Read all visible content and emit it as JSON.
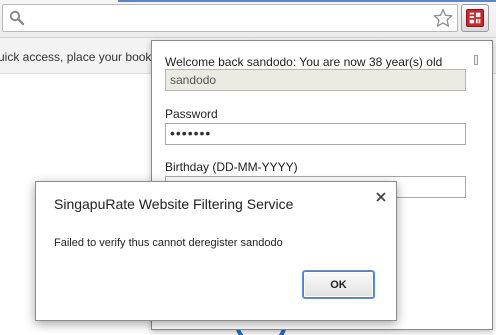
{
  "toolbar": {
    "search_icon": "search-icon",
    "star_icon": "star-icon",
    "extension_icon": "singapurate-extension-icon",
    "extension_color": "#c8272e"
  },
  "bookmark_bar": {
    "hint": "uick access, place your bookmarks"
  },
  "popup": {
    "welcome": "Welcome back sandodo: You are now 38 year(s) old",
    "username_value": "sandodo",
    "password_label": "Password",
    "password_value": "•••••••",
    "birthday_label": "Birthday (DD-MM-YYYY)",
    "birthday_value": ""
  },
  "dialog": {
    "title": "SingapuRate Website Filtering Service",
    "message": "Failed to verify thus cannot deregister sandodo",
    "ok_label": "OK",
    "close_icon": "close-icon"
  }
}
